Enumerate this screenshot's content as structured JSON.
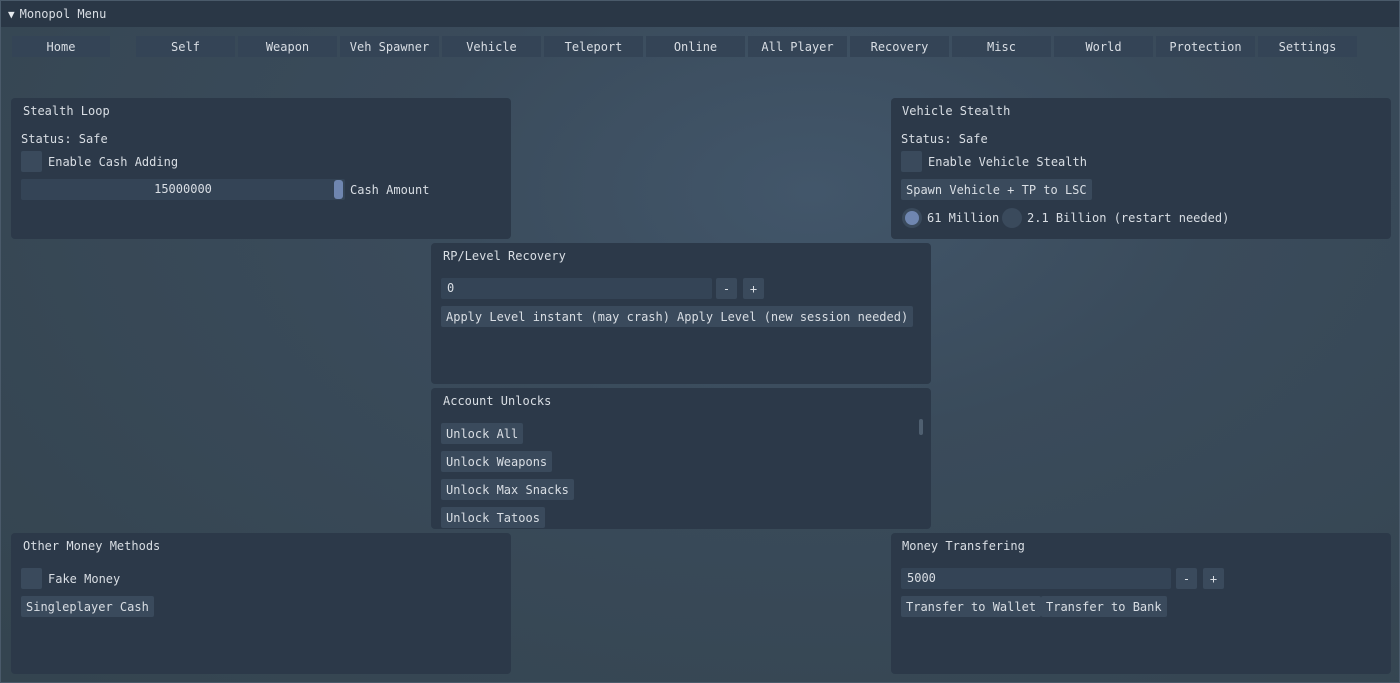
{
  "window": {
    "title": "Monopol Menu"
  },
  "tabs": [
    "Home",
    "Self",
    "Weapon",
    "Veh Spawner",
    "Vehicle",
    "Teleport",
    "Online",
    "All Player",
    "Recovery",
    "Misc",
    "World",
    "Protection",
    "Settings"
  ],
  "stealth_loop": {
    "title": "Stealth Loop",
    "status": "Status: Safe",
    "enable_label": "Enable Cash Adding",
    "amount_value": "15000000",
    "amount_label": "Cash Amount"
  },
  "vehicle_stealth": {
    "title": "Vehicle Stealth",
    "status": "Status: Safe",
    "enable_label": "Enable Vehicle Stealth",
    "spawn_button": "Spawn Vehicle + TP to LSC",
    "option_61m": "61 Million",
    "option_21b": "2.1 Billion (restart needed)",
    "selected": "61 Million"
  },
  "rp_level": {
    "title": "RP/Level Recovery",
    "value": "0",
    "minus": "-",
    "plus": "+",
    "apply_instant": "Apply Level instant (may crash)",
    "apply_session": "Apply Level (new session needed)"
  },
  "account_unlocks": {
    "title": "Account Unlocks",
    "items": [
      "Unlock All",
      "Unlock Weapons",
      "Unlock Max Snacks",
      "Unlock Tatoos"
    ]
  },
  "other_money": {
    "title": "Other Money Methods",
    "fake_money_label": "Fake Money",
    "singleplayer_button": "Singleplayer Cash"
  },
  "money_transfer": {
    "title": "Money Transfering",
    "value": "5000",
    "minus": "-",
    "plus": "+",
    "to_wallet": "Transfer to Wallet",
    "to_bank": "Transfer to Bank"
  }
}
